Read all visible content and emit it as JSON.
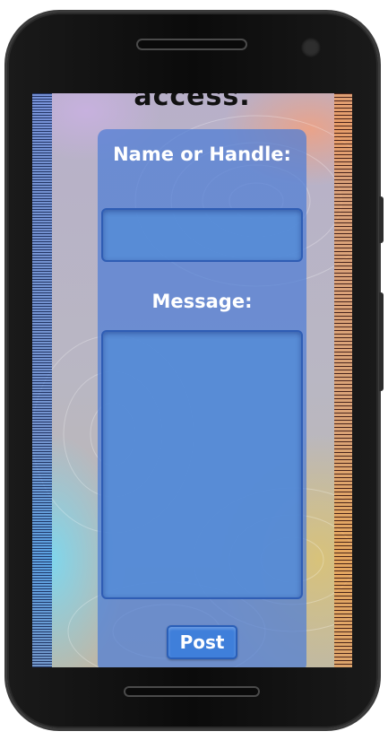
{
  "page": {
    "partial_heading": "access."
  },
  "form": {
    "name_label": "Name or Handle:",
    "name_value": "",
    "message_label": "Message:",
    "message_value": "",
    "post_label": "Post"
  },
  "colors": {
    "panel": "#4d7dd6",
    "field": "#558cd7",
    "button": "#3f7fda",
    "text": "#ffffff"
  }
}
